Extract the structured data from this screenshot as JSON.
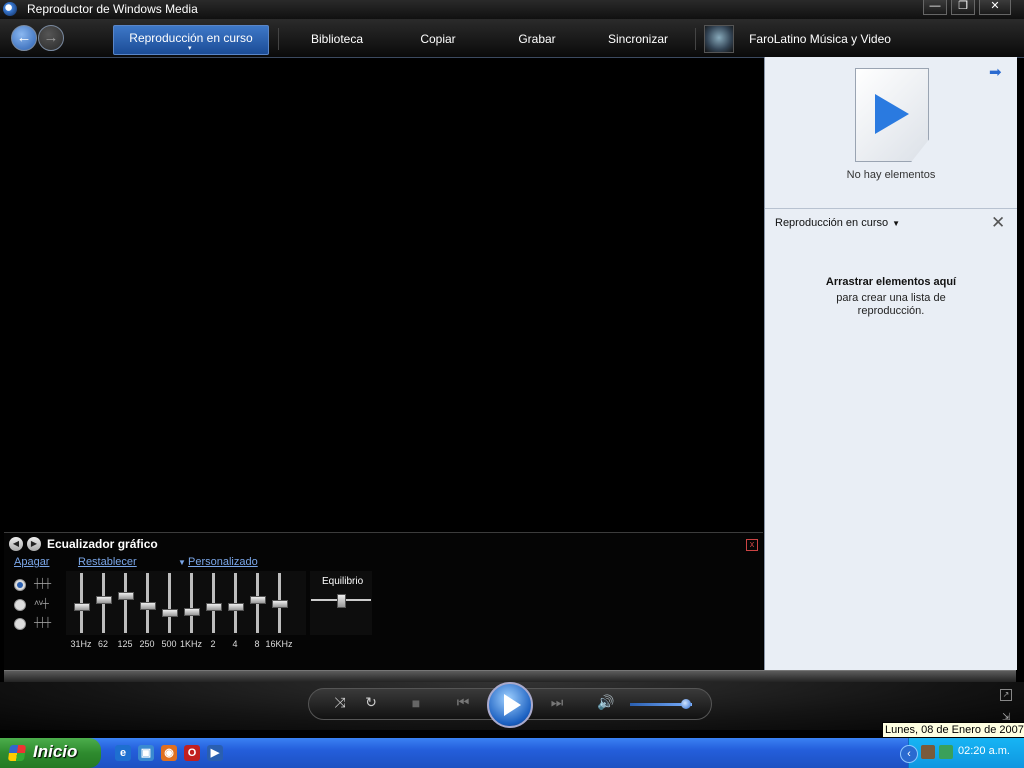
{
  "window": {
    "title": "Reproductor de Windows Media",
    "controls": {
      "minimize": "—",
      "restore": "❐",
      "close": "✕"
    }
  },
  "nav": {
    "back": "←",
    "forward": "→",
    "tabs": [
      {
        "label": "Reproducción en curso",
        "active": true
      },
      {
        "label": "Biblioteca"
      },
      {
        "label": "Copiar"
      },
      {
        "label": "Grabar"
      },
      {
        "label": "Sincronizar"
      }
    ],
    "store": "FaroLatino Música y Video",
    "active_caret": "▾"
  },
  "right_pane": {
    "arrow_icon": "➡",
    "no_items": "No hay elementos",
    "playlist_select": "Reproducción en curso",
    "playlist_dropdown": "▼",
    "clear_icon": "✕",
    "drag_title": "Arrastrar elementos aquí",
    "drag_subtitle": "para crear una lista de reproducción."
  },
  "equalizer": {
    "title": "Ecualizador gráfico",
    "nav_prev": "◀",
    "nav_next": "▶",
    "close": "x",
    "off_link": "Apagar",
    "reset_link": "Restablecer",
    "preset_arrow": "▼",
    "preset": "Personalizado",
    "mode_icons": [
      "┼┼┼",
      "˄˅┼",
      "┼┼┼"
    ],
    "selected_mode": 0,
    "bands": [
      {
        "label": "31Hz",
        "level": 0.45
      },
      {
        "label": "62",
        "level": 0.58
      },
      {
        "label": "125",
        "level": 0.65
      },
      {
        "label": "250",
        "level": 0.47
      },
      {
        "label": "500",
        "level": 0.33
      },
      {
        "label": "1KHz",
        "level": 0.35
      },
      {
        "label": "2",
        "level": 0.45
      },
      {
        "label": "4",
        "level": 0.45
      },
      {
        "label": "8",
        "level": 0.58
      },
      {
        "label": "16KHz",
        "level": 0.5
      }
    ],
    "balance_label": "Equilibrio",
    "balance": 0.5
  },
  "transport": {
    "shuffle": "⤨",
    "repeat": "↻",
    "stop": "■",
    "prev": "⏮",
    "next": "⏭",
    "mute": "🔊",
    "volume": 0.9,
    "mini_mode": "↗",
    "resize": "⇲"
  },
  "tooltip": "Lunes, 08 de Enero de 2007",
  "taskbar": {
    "start_label": "Inicio",
    "quick_launch": [
      {
        "name": "ie",
        "glyph": "e",
        "color": "#1e6fd0"
      },
      {
        "name": "explorer",
        "glyph": "▣",
        "color": "#3a8ad0"
      },
      {
        "name": "firefox",
        "glyph": "◉",
        "color": "#e07020"
      },
      {
        "name": "opera",
        "glyph": "O",
        "color": "#c02020"
      },
      {
        "name": "wmp",
        "glyph": "▶",
        "color": "#2a5fb0"
      }
    ],
    "tray_chevron": "‹",
    "clock": "02:20 a.m."
  }
}
